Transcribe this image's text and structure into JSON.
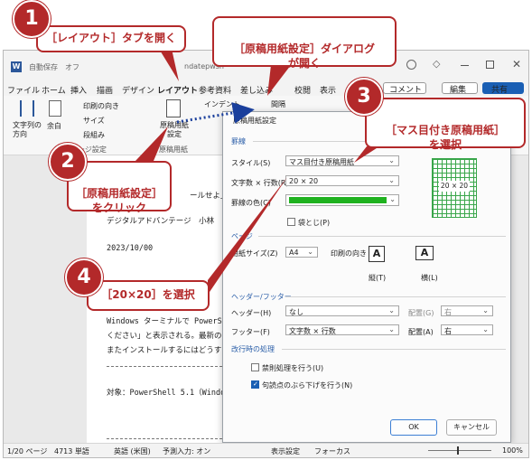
{
  "titlebar": {
    "autosave": "自動保存",
    "autosave_toggle": "オフ",
    "filename": "ndatepwsh"
  },
  "menubar": {
    "items": [
      "ファイル",
      "ホーム",
      "挿入",
      "描画",
      "デザイン",
      "レイアウト",
      "参考資料",
      "差し込み",
      "校閲",
      "表示",
      "ヘ"
    ],
    "comment": "コメント",
    "edit": "編集",
    "share": "共有"
  },
  "ribbon": {
    "text_direction": "文字列の方向",
    "margins": "余白",
    "print_orientation": "印刷の向き",
    "size": "サイズ",
    "columns": "段組み",
    "page_setup_group": "ページ設定",
    "manuscript_button": "原稿用紙設定",
    "manuscript_group": "原稿用紙",
    "indent": "インデント",
    "spacing": "間隔"
  },
  "document": {
    "lines": [
      "ールせよ」",
      "デジタルアドバンテージ　小林",
      "2023/10/00",
      "Windows ターミナルで PowerShe",
      "ください」と表示される。最新の",
      "またインストールするにはどうす",
      "対象：PowerShell 5.1（Windows"
    ]
  },
  "dialog": {
    "title": "原稿用紙設定",
    "section_grid": "罫線",
    "style_label": "スタイル(S)",
    "style_value": "マス目付き原稿用紙",
    "count_label": "文字数 × 行数(R)",
    "count_value": "20 × 20",
    "line_color_label": "罫線の色(C)",
    "fold_label": "袋とじ(P)",
    "section_page": "ページ",
    "paper_size_label": "用紙サイズ(Z)",
    "paper_size_value": "A4",
    "orientation_label": "印刷の向き",
    "portrait": "縦(T)",
    "landscape": "横(L)",
    "section_header": "ヘッダー/フッター",
    "header_label": "ヘッダー(H)",
    "header_value": "なし",
    "header_pos_label": "配置(G)",
    "header_pos_value": "右",
    "footer_label": "フッター(F)",
    "footer_value": "文字数 × 行数",
    "footer_pos_label": "配置(A)",
    "footer_pos_value": "右",
    "section_linebreak": "改行時の処理",
    "kinsoku_label": "禁則処理を行う(U)",
    "hanging_label": "句読点のぶら下げを行う(N)",
    "preview_label": "20 × 20",
    "ok": "OK",
    "cancel": "キャンセル"
  },
  "statusbar": {
    "page": "1/20 ページ",
    "words": "4713 単語",
    "language": "英語 (米国)",
    "predict": "予測入力: オン",
    "display_settings": "表示設定",
    "focus": "フォーカス",
    "zoom": "100%"
  },
  "callouts": {
    "c1": "［レイアウト］タブを開く",
    "c2": "［原稿用紙設定］\nをクリック",
    "c3": "［マス目付き原稿用紙］\nを選択",
    "c4": "［20×20］を選択",
    "c_dialog": "［原稿用紙設定］ダイアログ\nが開く",
    "n1": "1",
    "n2": "2",
    "n3": "3",
    "n4": "4"
  },
  "colors": {
    "accent": "#b3292a",
    "grid_green": "#1fb21f",
    "share_blue": "#1a5fb4"
  }
}
